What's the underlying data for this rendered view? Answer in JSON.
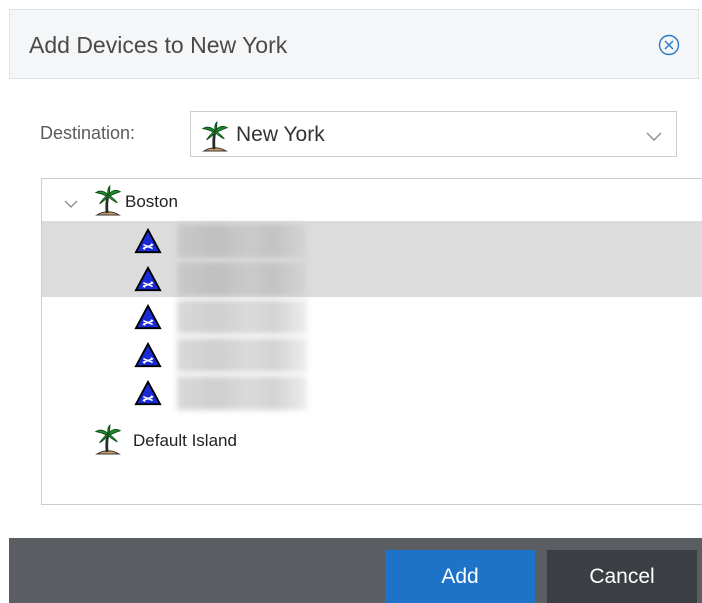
{
  "dialog": {
    "title": "Add Devices to New York",
    "close_icon": "close-circle-icon"
  },
  "destination": {
    "label": "Destination:",
    "value": "New York",
    "icon": "palm-tree-island-icon"
  },
  "tree": {
    "root": {
      "label": "Boston",
      "icon": "palm-tree-island-icon",
      "expanded": true
    },
    "devices": [
      {
        "icon": "router-triangle-icon",
        "name_obscured": true,
        "selected": true
      },
      {
        "icon": "router-triangle-icon",
        "name_obscured": true,
        "selected": true
      },
      {
        "icon": "router-triangle-icon",
        "name_obscured": true,
        "selected": false
      },
      {
        "icon": "router-triangle-icon",
        "name_obscured": true,
        "selected": false
      },
      {
        "icon": "router-triangle-icon",
        "name_obscured": true,
        "selected": false
      }
    ],
    "other": {
      "label": "Default Island",
      "icon": "palm-tree-island-icon"
    }
  },
  "footer": {
    "add_label": "Add",
    "cancel_label": "Cancel"
  },
  "colors": {
    "primary_button": "#1e73c8",
    "secondary_button": "#3b3f44",
    "footer_bg": "#5a5e63",
    "selection_bg": "#dcdcdc",
    "device_icon": "#1a2bd6"
  }
}
